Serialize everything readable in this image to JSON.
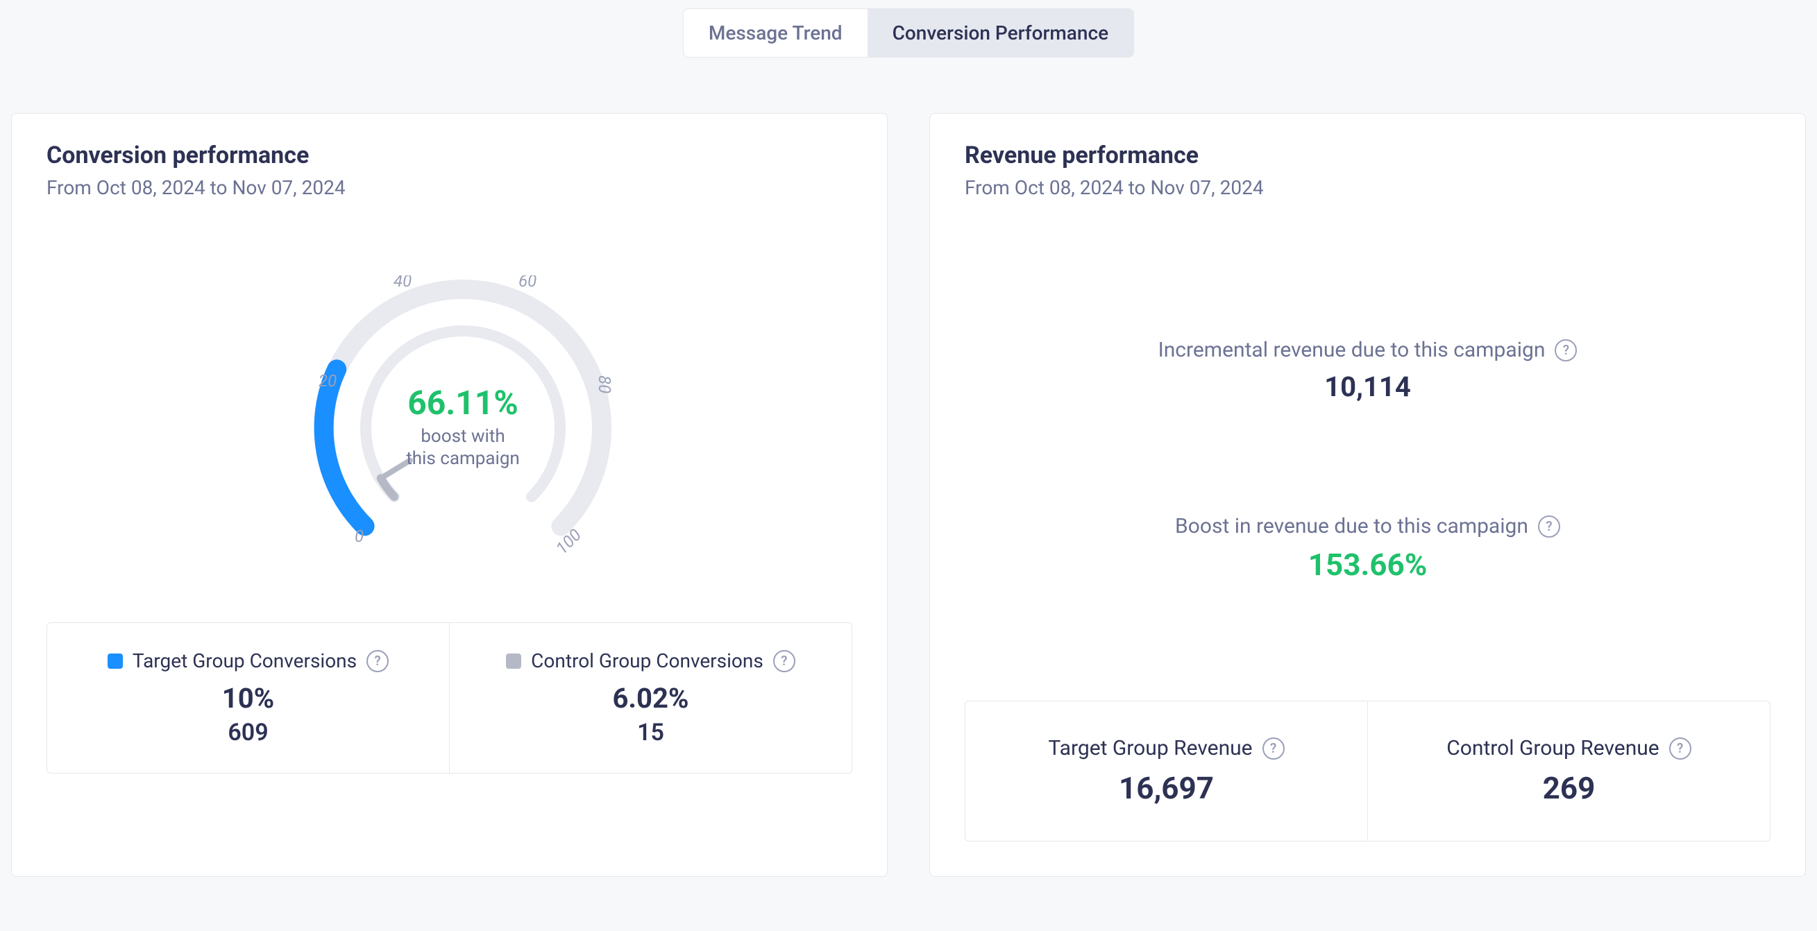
{
  "tabs": {
    "message_trend": "Message Trend",
    "conversion_performance": "Conversion Performance"
  },
  "conversion_card": {
    "title": "Conversion performance",
    "subtitle": "From Oct 08, 2024 to Nov 07, 2024",
    "boost_value": "66.11%",
    "boost_caption_1": "boost with",
    "boost_caption_2": "this campaign",
    "target_label": "Target Group Conversions",
    "target_pct": "10%",
    "target_count": "609",
    "control_label": "Control Group Conversions",
    "control_pct": "6.02%",
    "control_count": "15"
  },
  "revenue_card": {
    "title": "Revenue performance",
    "subtitle": "From Oct 08, 2024 to Nov 07, 2024",
    "incremental_label": "Incremental revenue due to this campaign",
    "incremental_value": "10,114",
    "boost_label": "Boost in revenue due to this campaign",
    "boost_value": "153.66%",
    "target_label": "Target Group Revenue",
    "target_value": "16,697",
    "control_label": "Control Group Revenue",
    "control_value": "269"
  },
  "chart_data": {
    "type": "gauge",
    "title": "Conversion boost",
    "value_target_pct": 10.0,
    "value_control_pct": 6.02,
    "boost_pct": 66.11,
    "range": [
      0,
      100
    ],
    "ticks": [
      0,
      20,
      40,
      60,
      80,
      100
    ],
    "series": [
      {
        "name": "Target Group Conversions",
        "value_pct": 10.0,
        "count": 609,
        "color": "#1a8fff"
      },
      {
        "name": "Control Group Conversions",
        "value_pct": 6.02,
        "count": 15,
        "color": "#b5b9c6"
      }
    ],
    "center_label": "66.11% boost with this campaign"
  }
}
